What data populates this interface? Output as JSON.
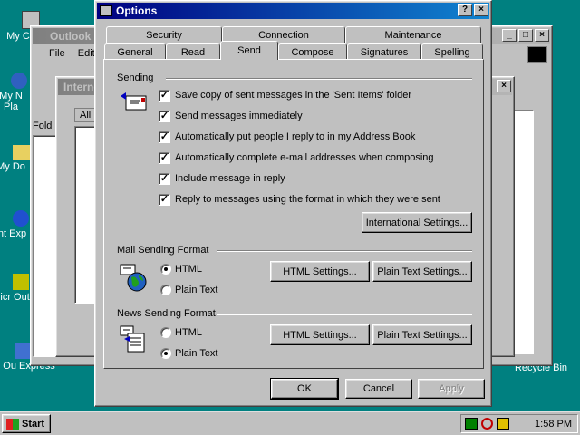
{
  "desktop": {
    "icons": [
      {
        "label": "My C"
      },
      {
        "label": "My N Pla"
      },
      {
        "label": "My Do"
      },
      {
        "label": "Int Exp"
      },
      {
        "label": "Micr Out"
      },
      {
        "label": "Ou Express"
      },
      {
        "label": "Recycle Bin"
      }
    ]
  },
  "outlook_window": {
    "title": "Outlook",
    "menu": [
      "File",
      "Edit"
    ],
    "folder_label": "Fold",
    "tab_all": "All"
  },
  "internet_window": {
    "title": "Interne"
  },
  "dialog": {
    "title": "Options",
    "tabs_row1": [
      "Security",
      "Connection",
      "Maintenance"
    ],
    "tabs_row2": [
      "General",
      "Read",
      "Send",
      "Compose",
      "Signatures",
      "Spelling"
    ],
    "selected_tab": "Send",
    "sending": {
      "group_label": "Sending",
      "options": [
        {
          "label": "Save copy of sent messages in the 'Sent Items' folder",
          "checked": true
        },
        {
          "label": "Send messages immediately",
          "checked": true
        },
        {
          "label": "Automatically put people I reply to in my Address Book",
          "checked": true
        },
        {
          "label": "Automatically complete e-mail addresses when composing",
          "checked": true
        },
        {
          "label": "Include message in reply",
          "checked": true
        },
        {
          "label": "Reply to messages using the format in which they were sent",
          "checked": true
        }
      ],
      "intl_button": "International Settings..."
    },
    "mail_format": {
      "group_label": "Mail Sending Format",
      "html_label": "HTML",
      "plain_label": "Plain Text",
      "selected": "HTML",
      "html_settings": "HTML Settings...",
      "plain_settings": "Plain Text Settings..."
    },
    "news_format": {
      "group_label": "News Sending Format",
      "html_label": "HTML",
      "plain_label": "Plain Text",
      "selected": "Plain Text",
      "html_settings": "HTML Settings...",
      "plain_settings": "Plain Text Settings..."
    },
    "buttons": {
      "ok": "OK",
      "cancel": "Cancel",
      "apply": "Apply"
    }
  },
  "taskbar": {
    "start_label": "Start",
    "clock": "1:58 PM"
  },
  "colors": {
    "title_active": "#000080",
    "face": "#c0c0c0",
    "desktop": "#008080"
  }
}
